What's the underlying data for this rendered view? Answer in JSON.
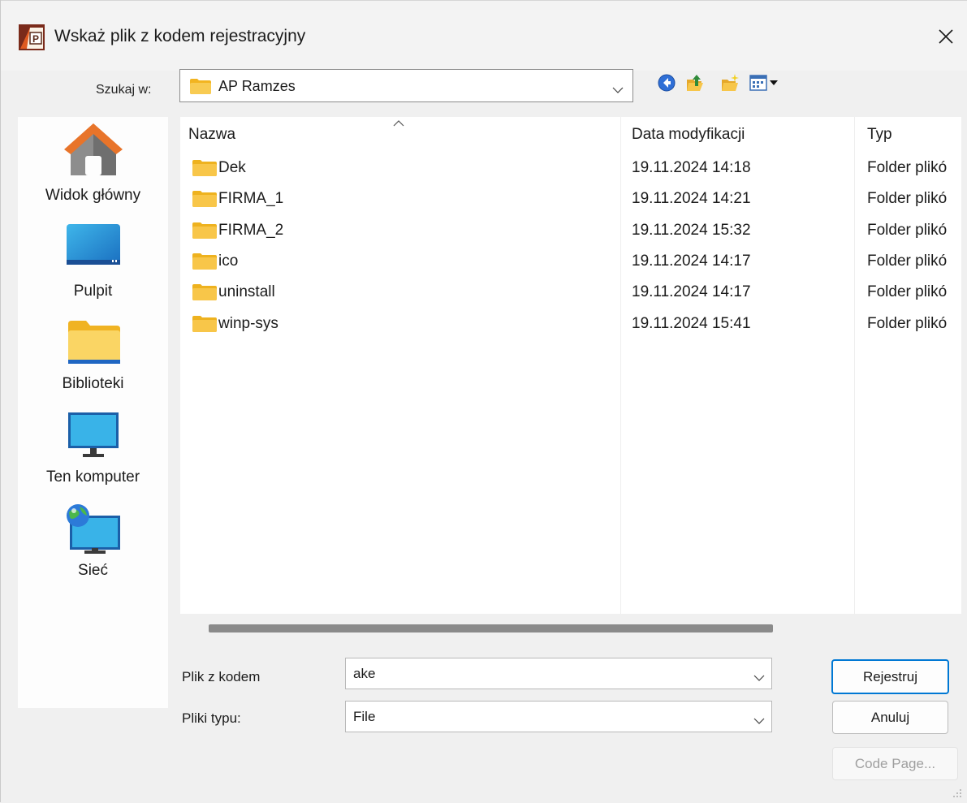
{
  "window": {
    "title": "Wskaż plik z kodem rejestracyjny",
    "app_icon": "app-logo-icon",
    "close_icon": "close-icon"
  },
  "lookin": {
    "label": "Szukaj w:",
    "value": "AP Ramzes",
    "toolbar_icons": [
      "back-icon",
      "up-folder-icon",
      "new-folder-icon",
      "view-menu-icon"
    ]
  },
  "places": [
    {
      "label": "Widok główny",
      "icon": "home-icon"
    },
    {
      "label": "Pulpit",
      "icon": "desktop-icon"
    },
    {
      "label": "Biblioteki",
      "icon": "libraries-icon"
    },
    {
      "label": "Ten komputer",
      "icon": "computer-icon"
    },
    {
      "label": "Sieć",
      "icon": "network-icon"
    }
  ],
  "file_list": {
    "columns": [
      "Nazwa",
      "Data modyfikacji",
      "Typ"
    ],
    "rows": [
      {
        "name": "Dek",
        "date": "19.11.2024 14:18",
        "type": "Folder plikó"
      },
      {
        "name": "FIRMA_1",
        "date": "19.11.2024 14:21",
        "type": "Folder plikó"
      },
      {
        "name": "FIRMA_2",
        "date": "19.11.2024 15:32",
        "type": "Folder plikó"
      },
      {
        "name": "ico",
        "date": "19.11.2024 14:17",
        "type": "Folder plikó"
      },
      {
        "name": "uninstall",
        "date": "19.11.2024 14:17",
        "type": "Folder plikó"
      },
      {
        "name": "winp-sys",
        "date": "19.11.2024 15:41",
        "type": "Folder plikó"
      }
    ]
  },
  "form": {
    "filename_label": "Plik z kodem",
    "filename_value": "ake",
    "filetype_label": "Pliki typu:",
    "filetype_value": "File"
  },
  "buttons": {
    "register": "Rejestruj",
    "cancel": "Anuluj",
    "codepage": "Code Page..."
  },
  "colors": {
    "folder": "#f8c649",
    "accent": "#0078d4"
  }
}
